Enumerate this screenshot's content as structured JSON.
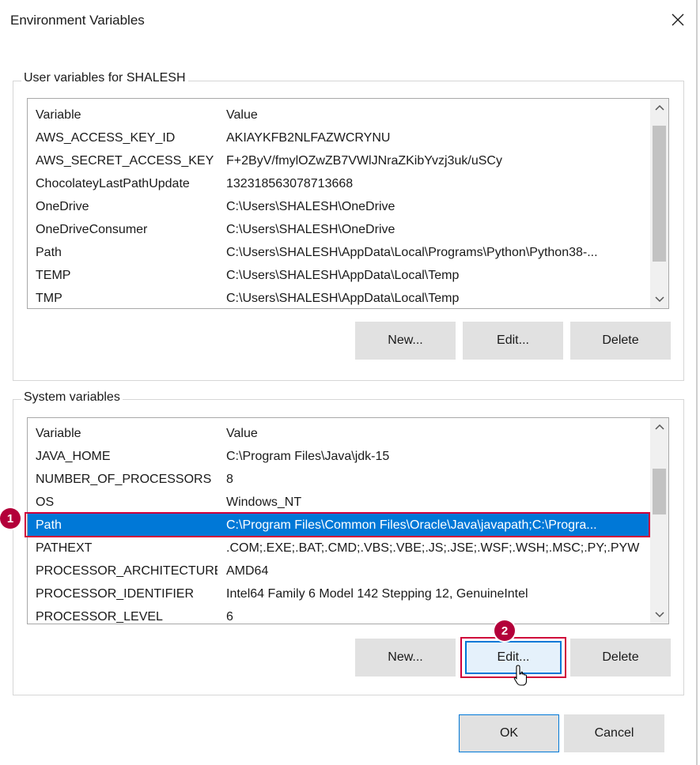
{
  "window": {
    "title": "Environment Variables",
    "close_icon": "close-icon"
  },
  "user_vars": {
    "label": "User variables for SHALESH",
    "columns": [
      "Variable",
      "Value"
    ],
    "rows": [
      {
        "variable": "AWS_ACCESS_KEY_ID",
        "value": "AKIAYKFB2NLFAZWCRYNU"
      },
      {
        "variable": "AWS_SECRET_ACCESS_KEY",
        "value": "F+2ByV/fmylOZwZB7VWlJNraZKibYvzj3uk/uSCy"
      },
      {
        "variable": "ChocolateyLastPathUpdate",
        "value": "132318563078713668"
      },
      {
        "variable": "OneDrive",
        "value": "C:\\Users\\SHALESH\\OneDrive"
      },
      {
        "variable": "OneDriveConsumer",
        "value": "C:\\Users\\SHALESH\\OneDrive"
      },
      {
        "variable": "Path",
        "value": "C:\\Users\\SHALESH\\AppData\\Local\\Programs\\Python\\Python38-..."
      },
      {
        "variable": "TEMP",
        "value": "C:\\Users\\SHALESH\\AppData\\Local\\Temp"
      },
      {
        "variable": "TMP",
        "value": "C:\\Users\\SHALESH\\AppData\\Local\\Temp"
      }
    ],
    "buttons": {
      "new": "New...",
      "edit": "Edit...",
      "delete": "Delete"
    }
  },
  "system_vars": {
    "label": "System variables",
    "columns": [
      "Variable",
      "Value"
    ],
    "rows": [
      {
        "variable": "JAVA_HOME",
        "value": "C:\\Program Files\\Java\\jdk-15"
      },
      {
        "variable": "NUMBER_OF_PROCESSORS",
        "value": "8"
      },
      {
        "variable": "OS",
        "value": "Windows_NT"
      },
      {
        "variable": "Path",
        "value": "C:\\Program Files\\Common Files\\Oracle\\Java\\javapath;C:\\Progra..."
      },
      {
        "variable": "PATHEXT",
        "value": ".COM;.EXE;.BAT;.CMD;.VBS;.VBE;.JS;.JSE;.WSF;.WSH;.MSC;.PY;.PYW"
      },
      {
        "variable": "PROCESSOR_ARCHITECTURE",
        "value": "AMD64"
      },
      {
        "variable": "PROCESSOR_IDENTIFIER",
        "value": "Intel64 Family 6 Model 142 Stepping 12, GenuineIntel"
      },
      {
        "variable": "PROCESSOR_LEVEL",
        "value": "6"
      }
    ],
    "selected_index": 3,
    "buttons": {
      "new": "New...",
      "edit": "Edit...",
      "delete": "Delete"
    }
  },
  "footer": {
    "ok": "OK",
    "cancel": "Cancel"
  },
  "annotations": {
    "step1": "1",
    "step2": "2"
  },
  "colors": {
    "selection": "#0078d7",
    "annotation": "#b3003a",
    "highlight_outline": "#d0003a"
  }
}
